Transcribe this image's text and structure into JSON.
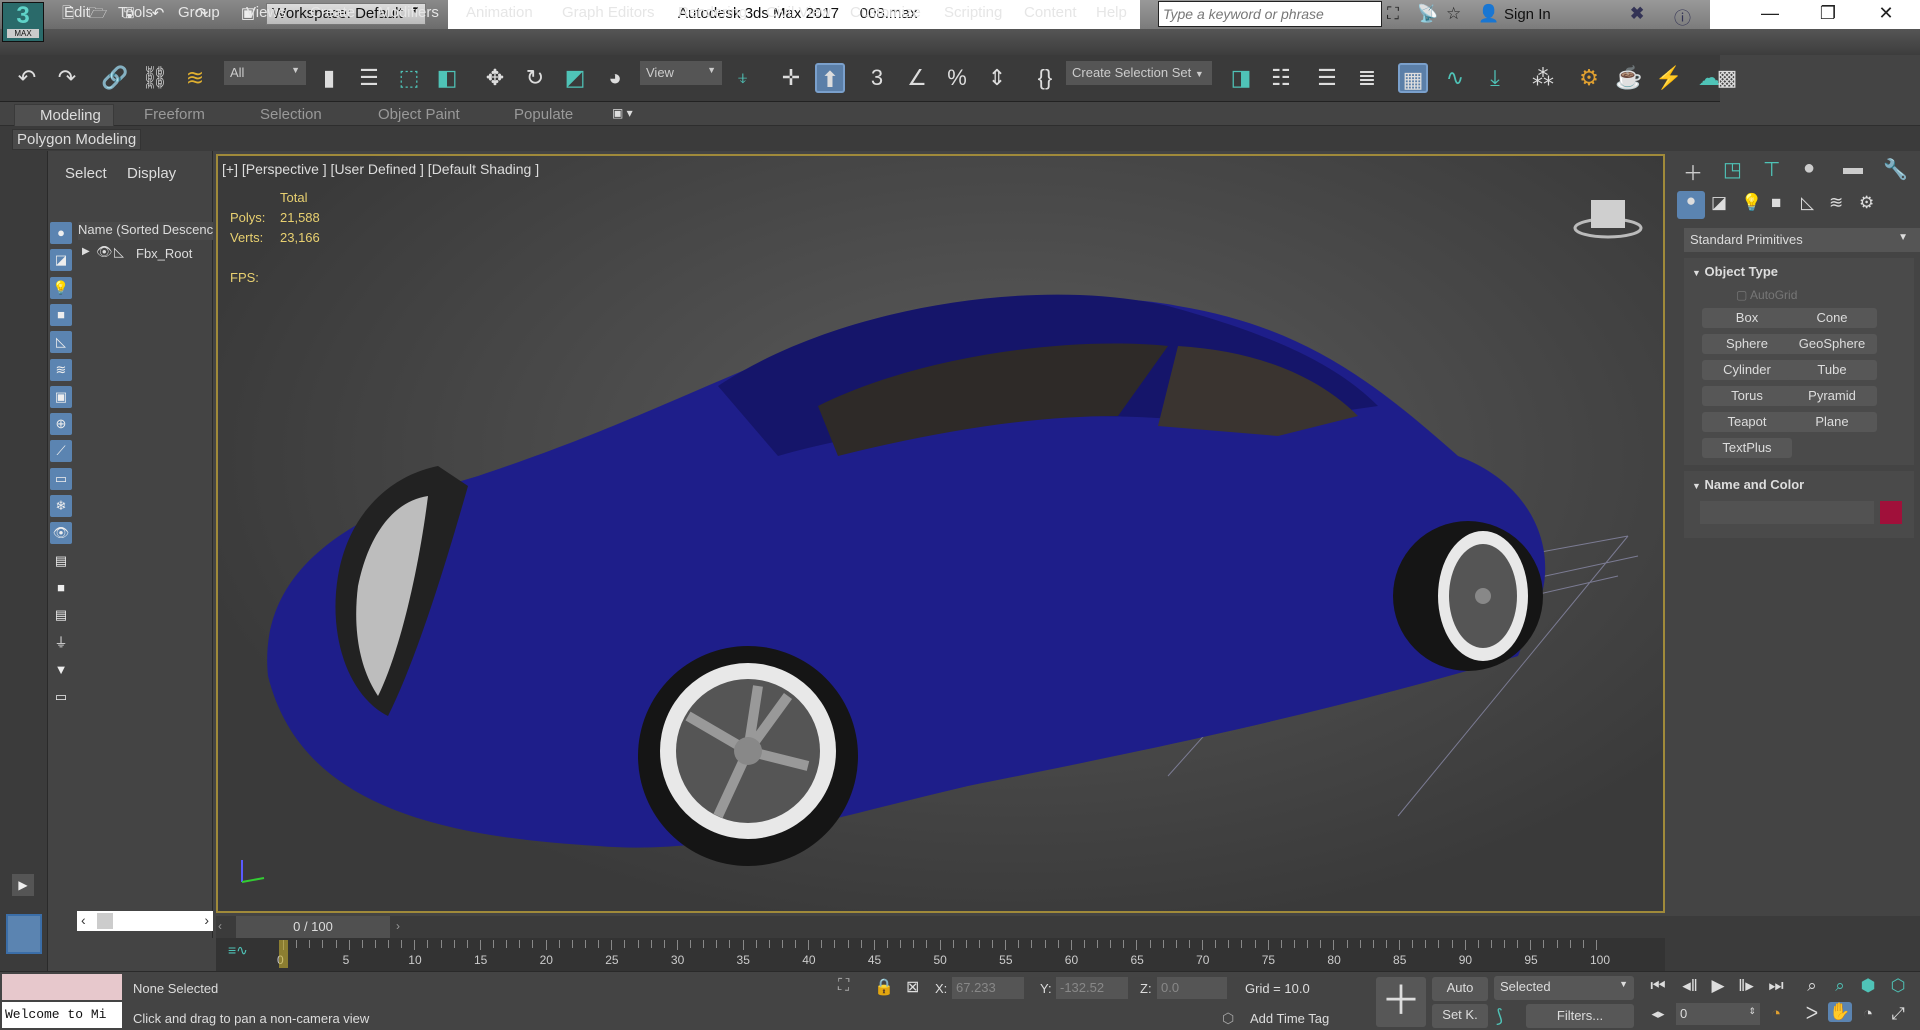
{
  "app": {
    "title": "Autodesk 3ds Max 2017",
    "file": "008.max",
    "logo_num": "3",
    "logo_text": "MAX"
  },
  "quick_access": {
    "workspace": "Workspace: Default",
    "icons": [
      "new-file-icon",
      "open-file-icon",
      "save-icon",
      "undo-icon",
      "redo-icon",
      "project-folder-icon"
    ]
  },
  "infocenter": {
    "search_placeholder": "Type a keyword or phrase",
    "sign_in": "Sign In"
  },
  "menus": [
    "Edit",
    "Tools",
    "Group",
    "Views",
    "Create",
    "Modifiers",
    "Animation",
    "Graph Editors",
    "Rendering",
    "Civil View",
    "Customize",
    "Scripting",
    "Content",
    "Help"
  ],
  "toolbar": {
    "filter": "All",
    "refcoord": "View",
    "selection_set": "Create Selection Set"
  },
  "ribbon": {
    "tabs": [
      "Modeling",
      "Freeform",
      "Selection",
      "Object Paint",
      "Populate"
    ],
    "panel": "Polygon Modeling"
  },
  "explorer": {
    "tabs": [
      "Select",
      "Display"
    ],
    "column": "Name (Sorted Descenc",
    "items": [
      "Fbx_Root"
    ]
  },
  "viewport": {
    "label": "[+] [Perspective ] [User Defined ] [Default Shading ]",
    "stats_header": "Total",
    "polys_label": "Polys:",
    "polys": "21,588",
    "verts_label": "Verts:",
    "verts": "23,166",
    "fps_label": "FPS:"
  },
  "command_panel": {
    "dropdown": "Standard Primitives",
    "object_type": "Object Type",
    "autogrid": "AutoGrid",
    "buttons": [
      "Box",
      "Cone",
      "Sphere",
      "GeoSphere",
      "Cylinder",
      "Tube",
      "Torus",
      "Pyramid",
      "Teapot",
      "Plane",
      "TextPlus"
    ],
    "name_and_color": "Name and Color",
    "color": "#a0103a"
  },
  "timeline": {
    "frame": "0 / 100",
    "current": 0,
    "max": 100,
    "labels": [
      "0",
      "5",
      "10",
      "15",
      "20",
      "25",
      "30",
      "35",
      "40",
      "45",
      "50",
      "55",
      "60",
      "65",
      "70",
      "75",
      "80",
      "85",
      "90",
      "95",
      "100"
    ]
  },
  "status": {
    "selection": "None Selected",
    "prompt": "Click and drag to pan a non-camera view",
    "maxscript": "Welcome to Mi",
    "x_label": "X:",
    "x": "67.233",
    "y_label": "Y:",
    "y": "-132.52",
    "z_label": "Z:",
    "z": "0.0",
    "grid": "Grid = 10.0",
    "add_time_tag": "Add Time Tag",
    "auto": "Auto",
    "set_key": "Set K.",
    "key_filter": "Selected",
    "filters": "Filters...",
    "frame": "0"
  }
}
